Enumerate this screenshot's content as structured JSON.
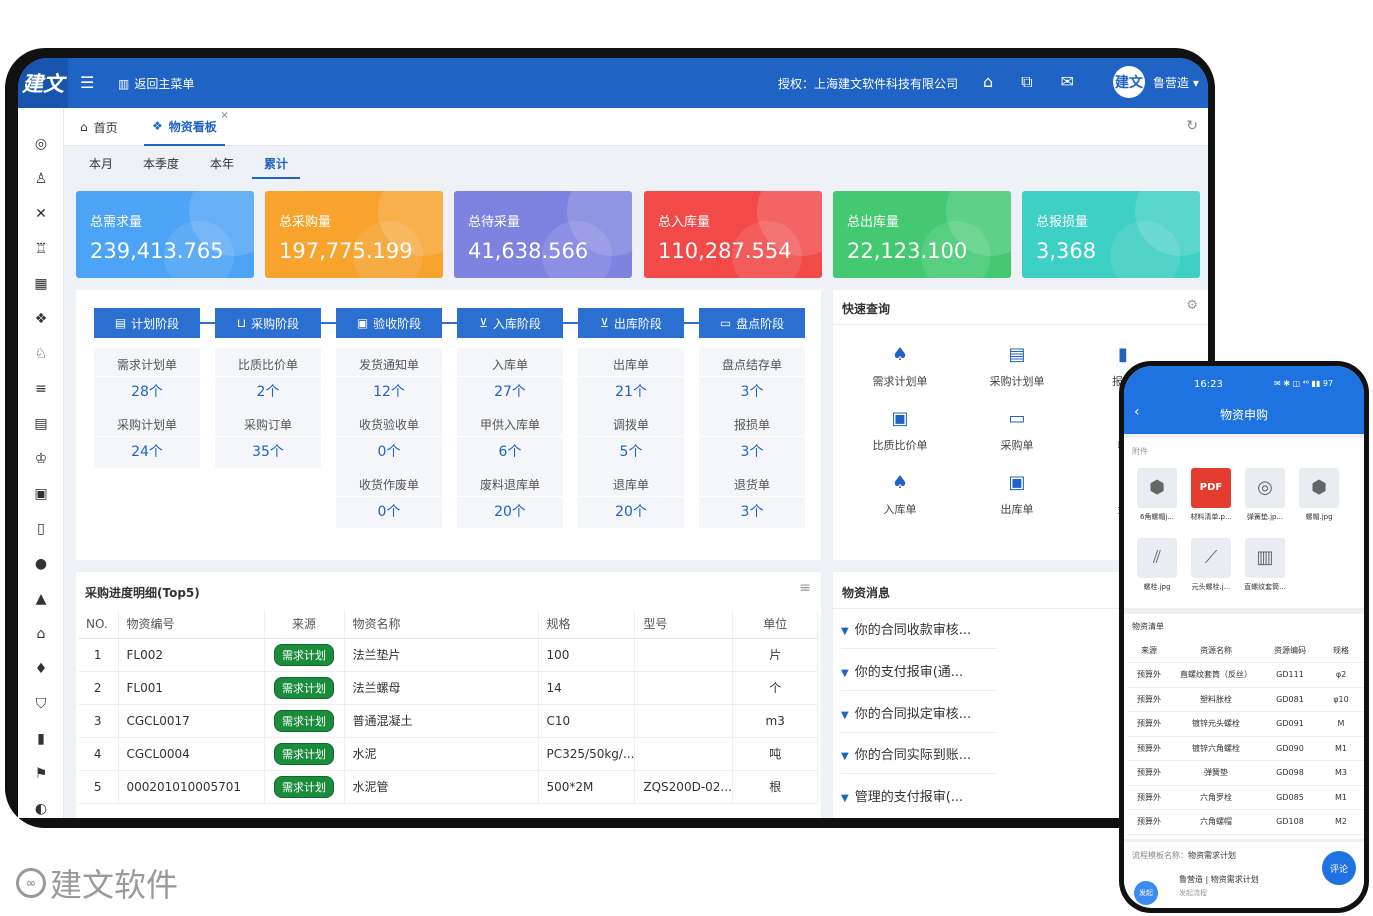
{
  "topbar": {
    "logo": "建文",
    "back_main": "返回主菜单",
    "auth": "授权：上海建文软件科技有限公司",
    "avatar": "建文",
    "user_name": "鲁营造 ▾"
  },
  "tabs": {
    "home": "首页",
    "board": "物资看板"
  },
  "periods": [
    "本月",
    "本季度",
    "本年",
    "累计"
  ],
  "cards": [
    {
      "label": "总需求量",
      "value": "239,413.765",
      "color": "#4da3f5"
    },
    {
      "label": "总采购量",
      "value": "197,775.199",
      "color": "#f7a32e"
    },
    {
      "label": "总待采量",
      "value": "41,638.566",
      "color": "#7f83e0"
    },
    {
      "label": "总入库量",
      "value": "110,287.554",
      "color": "#f14a49"
    },
    {
      "label": "总出库量",
      "value": "22,123.100",
      "color": "#44c972"
    },
    {
      "label": "总报损量",
      "value": "3,368",
      "color": "#3ecfc5"
    }
  ],
  "stages": [
    {
      "name": "计划阶段",
      "items": [
        {
          "t": "需求计划单",
          "n": "28个"
        },
        {
          "t": "采购计划单",
          "n": "24个"
        }
      ]
    },
    {
      "name": "采购阶段",
      "items": [
        {
          "t": "比质比价单",
          "n": "2个"
        },
        {
          "t": "采购订单",
          "n": "35个"
        }
      ]
    },
    {
      "name": "验收阶段",
      "items": [
        {
          "t": "发货通知单",
          "n": "12个"
        },
        {
          "t": "收货验收单",
          "n": "0个"
        },
        {
          "t": "收货作废单",
          "n": "0个"
        }
      ]
    },
    {
      "name": "入库阶段",
      "items": [
        {
          "t": "入库单",
          "n": "27个"
        },
        {
          "t": "甲供入库单",
          "n": "6个"
        },
        {
          "t": "废料退库单",
          "n": "20个"
        }
      ]
    },
    {
      "name": "出库阶段",
      "items": [
        {
          "t": "出库单",
          "n": "21个"
        },
        {
          "t": "调拨单",
          "n": "5个"
        },
        {
          "t": "退库单",
          "n": "20个"
        }
      ]
    },
    {
      "name": "盘点阶段",
      "items": [
        {
          "t": "盘点结存单",
          "n": "3个"
        },
        {
          "t": "报损单",
          "n": "3个"
        },
        {
          "t": "退货单",
          "n": "3个"
        }
      ]
    }
  ],
  "quick": {
    "title": "快速查询",
    "items": [
      "需求计划单",
      "采购计划单",
      "报价",
      "比质比价单",
      "采购单",
      "收",
      "入库单",
      "出库单",
      "盘"
    ]
  },
  "detail": {
    "title": "采购进度明细(Top5)",
    "headers": [
      "NO.",
      "物资编号",
      "来源",
      "物资名称",
      "规格",
      "型号",
      "单位"
    ],
    "rows": [
      [
        "1",
        "FL002",
        "需求计划",
        "法兰垫片",
        "100",
        "",
        "片"
      ],
      [
        "2",
        "FL001",
        "需求计划",
        "法兰螺母",
        "14",
        "",
        "个"
      ],
      [
        "3",
        "CGCL0017",
        "需求计划",
        "普通混凝土",
        "C10",
        "",
        "m3"
      ],
      [
        "4",
        "CGCL0004",
        "需求计划",
        "水泥",
        "PC325/50kg/...",
        "",
        "吨"
      ],
      [
        "5",
        "000201010005701",
        "需求计划",
        "水泥管",
        "500*2M",
        "ZQS200D-02...",
        "根"
      ]
    ]
  },
  "messages": {
    "title": "物资消息",
    "items": [
      "你的合同收款审核...",
      "你的支付报审(通...",
      "你的合同拟定审核...",
      "你的合同实际到账...",
      "管理的支付报审(..."
    ]
  },
  "phone": {
    "time": "16:23",
    "status": "✉ ✱ ◫ ⁴⁶ ▮▮ 97",
    "title": "物资申购",
    "attach_label": "附件",
    "attachments": [
      "6角螺帽j...",
      "材料清单.p...",
      "弹簧垫.jp...",
      "螺帽.jpg",
      "螺栓.jpg",
      "元头螺栓.j...",
      "直螺纹套筒..."
    ],
    "list_title": "物资清单",
    "list_headers": [
      "来源",
      "资源名称",
      "资源编码",
      "规格"
    ],
    "list_rows": [
      [
        "预算外",
        "直螺纹套筒（反丝）",
        "GD111",
        "φ2"
      ],
      [
        "预算外",
        "塑料胀栓",
        "GD081",
        "φ10"
      ],
      [
        "预算外",
        "镀锌元头螺栓",
        "GD091",
        "M"
      ],
      [
        "预算外",
        "镀锌六角螺栓",
        "GD090",
        "M1"
      ],
      [
        "预算外",
        "弹簧垫",
        "GD098",
        "M3"
      ],
      [
        "预算外",
        "六角罗栓",
        "GD085",
        "M1"
      ],
      [
        "预算外",
        "六角螺帽",
        "GD108",
        "M2"
      ]
    ],
    "flow_label": "流程模板名称：",
    "flow_value": "物资需求计划",
    "flow_item": "鲁营造 | 物资需求计划",
    "flow_sub": "发起流程",
    "comment": "评论",
    "start": "发起"
  },
  "brand": {
    "name": "建文软件"
  }
}
